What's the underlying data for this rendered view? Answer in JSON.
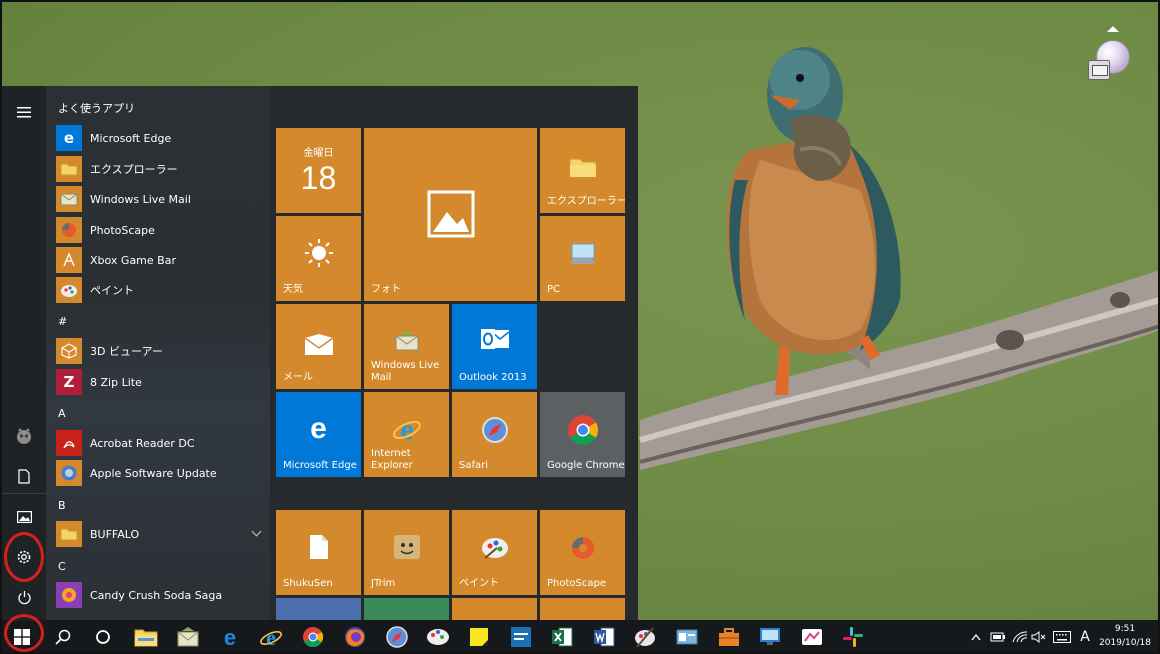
{
  "start_menu": {
    "header_frequent": "よく使うアプリ",
    "frequent_apps": [
      {
        "label": "Microsoft Edge",
        "icon": "edge-icon",
        "color": "#0078d7"
      },
      {
        "label": "エクスプローラー",
        "icon": "folder-icon",
        "color": "#d48a2c"
      },
      {
        "label": "Windows Live Mail",
        "icon": "mail-icon",
        "color": "#d48a2c"
      },
      {
        "label": "PhotoScape",
        "icon": "photoscape-icon",
        "color": "#d48a2c"
      },
      {
        "label": "Xbox Game Bar",
        "icon": "xbox-icon",
        "color": "#d48a2c"
      },
      {
        "label": "ペイント",
        "icon": "paint-icon",
        "color": "#d48a2c"
      }
    ],
    "section_hash": "#",
    "hash_apps": [
      {
        "label": "3D ビューアー",
        "icon": "cube-icon",
        "color": "#d48a2c"
      },
      {
        "label": "8 Zip Lite",
        "icon": "zip-icon",
        "color": "#b01e3a"
      }
    ],
    "section_a": "A",
    "a_apps": [
      {
        "label": "Acrobat Reader DC",
        "icon": "acrobat-icon",
        "color": "#c9221b"
      },
      {
        "label": "Apple Software Update",
        "icon": "apple-update-icon",
        "color": "#4b7bc0"
      }
    ],
    "section_b": "B",
    "b_apps": [
      {
        "label": "BUFFALO",
        "icon": "folder-icon",
        "color": "#d48a2c"
      }
    ],
    "section_c": "C",
    "c_apps": [
      {
        "label": "Candy Crush Soda Saga",
        "icon": "candy-icon",
        "color": "#8a3fb5"
      }
    ],
    "tiles": {
      "calendar_day": "金曜日",
      "calendar_date": "18",
      "explorer": "エクスプローラー",
      "weather": "天気",
      "photos": "フォト",
      "pc": "PC",
      "mail": "メール",
      "live_mail": "Windows Live Mail",
      "outlook": "Outlook 2013",
      "edge": "Microsoft Edge",
      "ie": "Internet Explorer",
      "safari": "Safari",
      "chrome": "Google Chrome",
      "shukusen": "ShukuSen",
      "jtrim": "JTrim",
      "paint": "ペイント",
      "photoscape": "PhotoScape"
    }
  },
  "taskbar": {
    "ime_mode": "A",
    "time": "9:51",
    "date": "2019/10/18"
  },
  "colors": {
    "tile_orange": "#d48a2c",
    "tile_blue": "#0078d7",
    "tile_grey": "#5d6063",
    "highlight_ring": "#d81e1e"
  }
}
